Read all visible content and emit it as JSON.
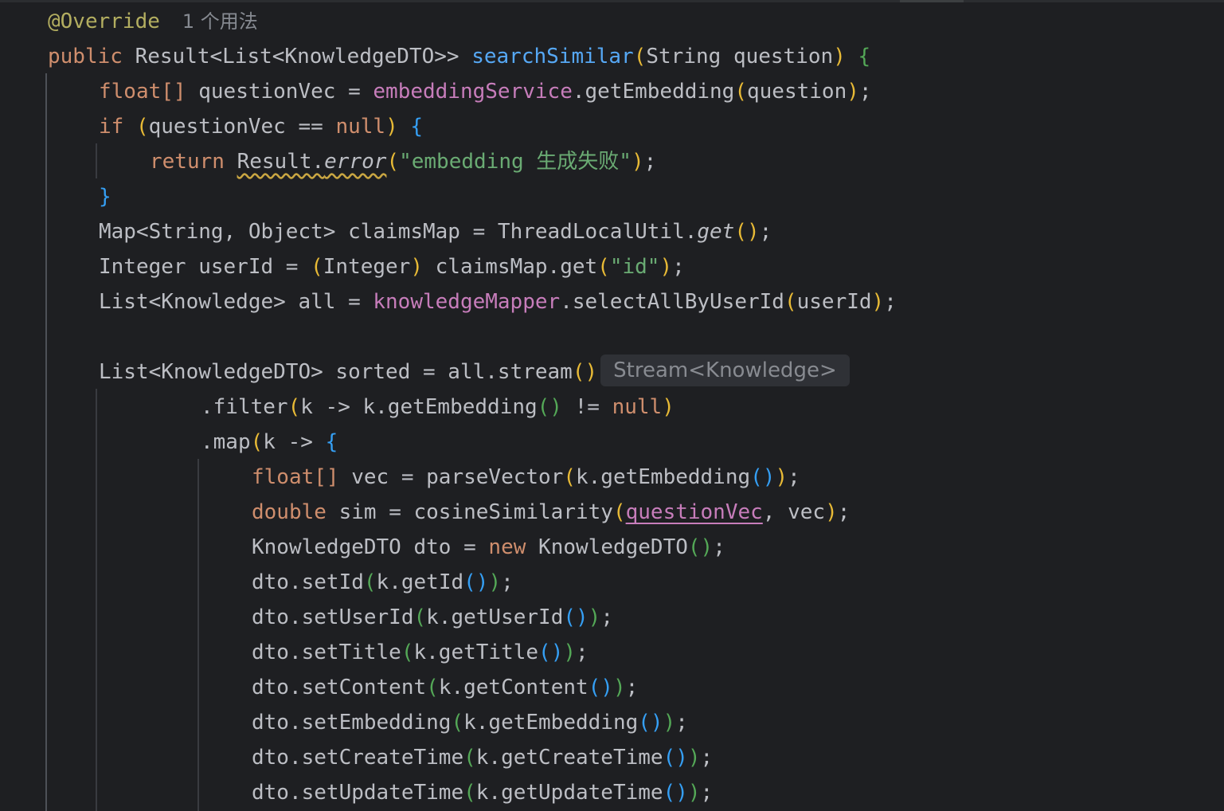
{
  "editor": {
    "language": "java",
    "colors": {
      "background": "#1e1f22",
      "keyword": "#cf8e6d",
      "annotation": "#b3ae60",
      "method_declaration": "#56a8f5",
      "field": "#c77dbb",
      "string": "#6aab73",
      "text": "#bcbec4",
      "bracket_level_1": "#e8ba36",
      "bracket_level_2": "#54a857",
      "bracket_level_3": "#359ff4",
      "inlay_hint": "#888b91"
    },
    "usage_hint": "1 个用法",
    "lines": [
      [
        {
          "t": "@Override",
          "c": "annot"
        },
        {
          "t": "1 个用法",
          "c": "hint"
        }
      ],
      [
        {
          "t": "public ",
          "c": "kw"
        },
        {
          "t": "Result<List<KnowledgeDTO>> ",
          "c": "type"
        },
        {
          "t": "searchSimilar",
          "c": "fn"
        },
        {
          "t": "(",
          "c": "p1"
        },
        {
          "t": "String question",
          "c": "plain"
        },
        {
          "t": ") ",
          "c": "p1"
        },
        {
          "t": "{",
          "c": "p2"
        }
      ],
      [
        {
          "t": "float[] ",
          "c": "kw"
        },
        {
          "t": "questionVec = ",
          "c": "plain"
        },
        {
          "t": "embeddingService",
          "c": "field"
        },
        {
          "t": ".getEmbedding",
          "c": "plain"
        },
        {
          "t": "(",
          "c": "p1"
        },
        {
          "t": "question",
          "c": "plain"
        },
        {
          "t": ")",
          "c": "p1"
        },
        {
          "t": ";",
          "c": "plain"
        }
      ],
      [
        {
          "t": "if ",
          "c": "kw"
        },
        {
          "t": "(",
          "c": "p1"
        },
        {
          "t": "questionVec == ",
          "c": "plain"
        },
        {
          "t": "null",
          "c": "kw"
        },
        {
          "t": ") ",
          "c": "p1"
        },
        {
          "t": "{",
          "c": "p3"
        }
      ],
      [
        {
          "t": "return ",
          "c": "kw"
        },
        {
          "t": "Result.",
          "c": "plain warn"
        },
        {
          "t": "error",
          "c": "plain ital warn"
        },
        {
          "t": "(",
          "c": "p1"
        },
        {
          "t": "\"embedding 生成失败\"",
          "c": "str"
        },
        {
          "t": ")",
          "c": "p1"
        },
        {
          "t": ";",
          "c": "plain"
        }
      ],
      [
        {
          "t": "}",
          "c": "p3"
        }
      ],
      [
        {
          "t": "Map<String, Object> ",
          "c": "type"
        },
        {
          "t": "claimsMap = ThreadLocalUtil.",
          "c": "plain"
        },
        {
          "t": "get",
          "c": "plain ital"
        },
        {
          "t": "()",
          "c": "p1"
        },
        {
          "t": ";",
          "c": "plain"
        }
      ],
      [
        {
          "t": "Integer userId = ",
          "c": "plain"
        },
        {
          "t": "(",
          "c": "p1"
        },
        {
          "t": "Integer",
          "c": "plain"
        },
        {
          "t": ") ",
          "c": "p1"
        },
        {
          "t": "claimsMap.get",
          "c": "plain"
        },
        {
          "t": "(",
          "c": "p1"
        },
        {
          "t": "\"id\"",
          "c": "str"
        },
        {
          "t": ")",
          "c": "p1"
        },
        {
          "t": ";",
          "c": "plain"
        }
      ],
      [
        {
          "t": "List<Knowledge> ",
          "c": "type"
        },
        {
          "t": "all = ",
          "c": "plain"
        },
        {
          "t": "knowledgeMapper",
          "c": "field"
        },
        {
          "t": ".selectAllByUserId",
          "c": "plain"
        },
        {
          "t": "(",
          "c": "p1"
        },
        {
          "t": "userId",
          "c": "plain"
        },
        {
          "t": ")",
          "c": "p1"
        },
        {
          "t": ";",
          "c": "plain"
        }
      ],
      [],
      [
        {
          "t": "List<KnowledgeDTO> ",
          "c": "type"
        },
        {
          "t": "sorted = all.stream",
          "c": "plain"
        },
        {
          "t": "()",
          "c": "p1"
        },
        {
          "t": "Stream<Knowledge>",
          "c": "inlay"
        }
      ],
      [
        {
          "t": ".filter",
          "c": "plain"
        },
        {
          "t": "(",
          "c": "p1"
        },
        {
          "t": "k -> k.getEmbedding",
          "c": "plain"
        },
        {
          "t": "() ",
          "c": "p2"
        },
        {
          "t": "!= ",
          "c": "plain"
        },
        {
          "t": "null",
          "c": "kw"
        },
        {
          "t": ")",
          "c": "p1"
        }
      ],
      [
        {
          "t": ".map",
          "c": "plain"
        },
        {
          "t": "(",
          "c": "p1"
        },
        {
          "t": "k -> ",
          "c": "plain"
        },
        {
          "t": "{",
          "c": "p3"
        }
      ],
      [
        {
          "t": "float[] ",
          "c": "kw"
        },
        {
          "t": "vec = parseVector",
          "c": "plain"
        },
        {
          "t": "(",
          "c": "p1"
        },
        {
          "t": "k.getEmbedding",
          "c": "plain"
        },
        {
          "t": "()",
          "c": "p3"
        },
        {
          "t": ")",
          "c": "p1"
        },
        {
          "t": ";",
          "c": "plain"
        }
      ],
      [
        {
          "t": "double ",
          "c": "kw"
        },
        {
          "t": "sim = cosineSimilarity",
          "c": "plain"
        },
        {
          "t": "(",
          "c": "p1"
        },
        {
          "t": "questionVec",
          "c": "field uline"
        },
        {
          "t": ", vec",
          "c": "plain"
        },
        {
          "t": ")",
          "c": "p1"
        },
        {
          "t": ";",
          "c": "plain"
        }
      ],
      [
        {
          "t": "KnowledgeDTO dto = ",
          "c": "plain"
        },
        {
          "t": "new ",
          "c": "kw"
        },
        {
          "t": "KnowledgeDTO",
          "c": "plain"
        },
        {
          "t": "()",
          "c": "p2"
        },
        {
          "t": ";",
          "c": "plain"
        }
      ],
      [
        {
          "t": "dto.setId",
          "c": "plain"
        },
        {
          "t": "(",
          "c": "p2"
        },
        {
          "t": "k.getId",
          "c": "plain"
        },
        {
          "t": "()",
          "c": "p3"
        },
        {
          "t": ")",
          "c": "p2"
        },
        {
          "t": ";",
          "c": "plain"
        }
      ],
      [
        {
          "t": "dto.setUserId",
          "c": "plain"
        },
        {
          "t": "(",
          "c": "p2"
        },
        {
          "t": "k.getUserId",
          "c": "plain"
        },
        {
          "t": "()",
          "c": "p3"
        },
        {
          "t": ")",
          "c": "p2"
        },
        {
          "t": ";",
          "c": "plain"
        }
      ],
      [
        {
          "t": "dto.setTitle",
          "c": "plain"
        },
        {
          "t": "(",
          "c": "p2"
        },
        {
          "t": "k.getTitle",
          "c": "plain"
        },
        {
          "t": "()",
          "c": "p3"
        },
        {
          "t": ")",
          "c": "p2"
        },
        {
          "t": ";",
          "c": "plain"
        }
      ],
      [
        {
          "t": "dto.setContent",
          "c": "plain"
        },
        {
          "t": "(",
          "c": "p2"
        },
        {
          "t": "k.getContent",
          "c": "plain"
        },
        {
          "t": "()",
          "c": "p3"
        },
        {
          "t": ")",
          "c": "p2"
        },
        {
          "t": ";",
          "c": "plain"
        }
      ],
      [
        {
          "t": "dto.setEmbedding",
          "c": "plain"
        },
        {
          "t": "(",
          "c": "p2"
        },
        {
          "t": "k.getEmbedding",
          "c": "plain"
        },
        {
          "t": "()",
          "c": "p3"
        },
        {
          "t": ")",
          "c": "p2"
        },
        {
          "t": ";",
          "c": "plain"
        }
      ],
      [
        {
          "t": "dto.setCreateTime",
          "c": "plain"
        },
        {
          "t": "(",
          "c": "p2"
        },
        {
          "t": "k.getCreateTime",
          "c": "plain"
        },
        {
          "t": "()",
          "c": "p3"
        },
        {
          "t": ")",
          "c": "p2"
        },
        {
          "t": ";",
          "c": "plain"
        }
      ],
      [
        {
          "t": "dto.setUpdateTime",
          "c": "plain"
        },
        {
          "t": "(",
          "c": "p2"
        },
        {
          "t": "k.getUpdateTime",
          "c": "plain"
        },
        {
          "t": "()",
          "c": "p3"
        },
        {
          "t": ")",
          "c": "p2"
        },
        {
          "t": ";",
          "c": "plain"
        }
      ]
    ]
  }
}
